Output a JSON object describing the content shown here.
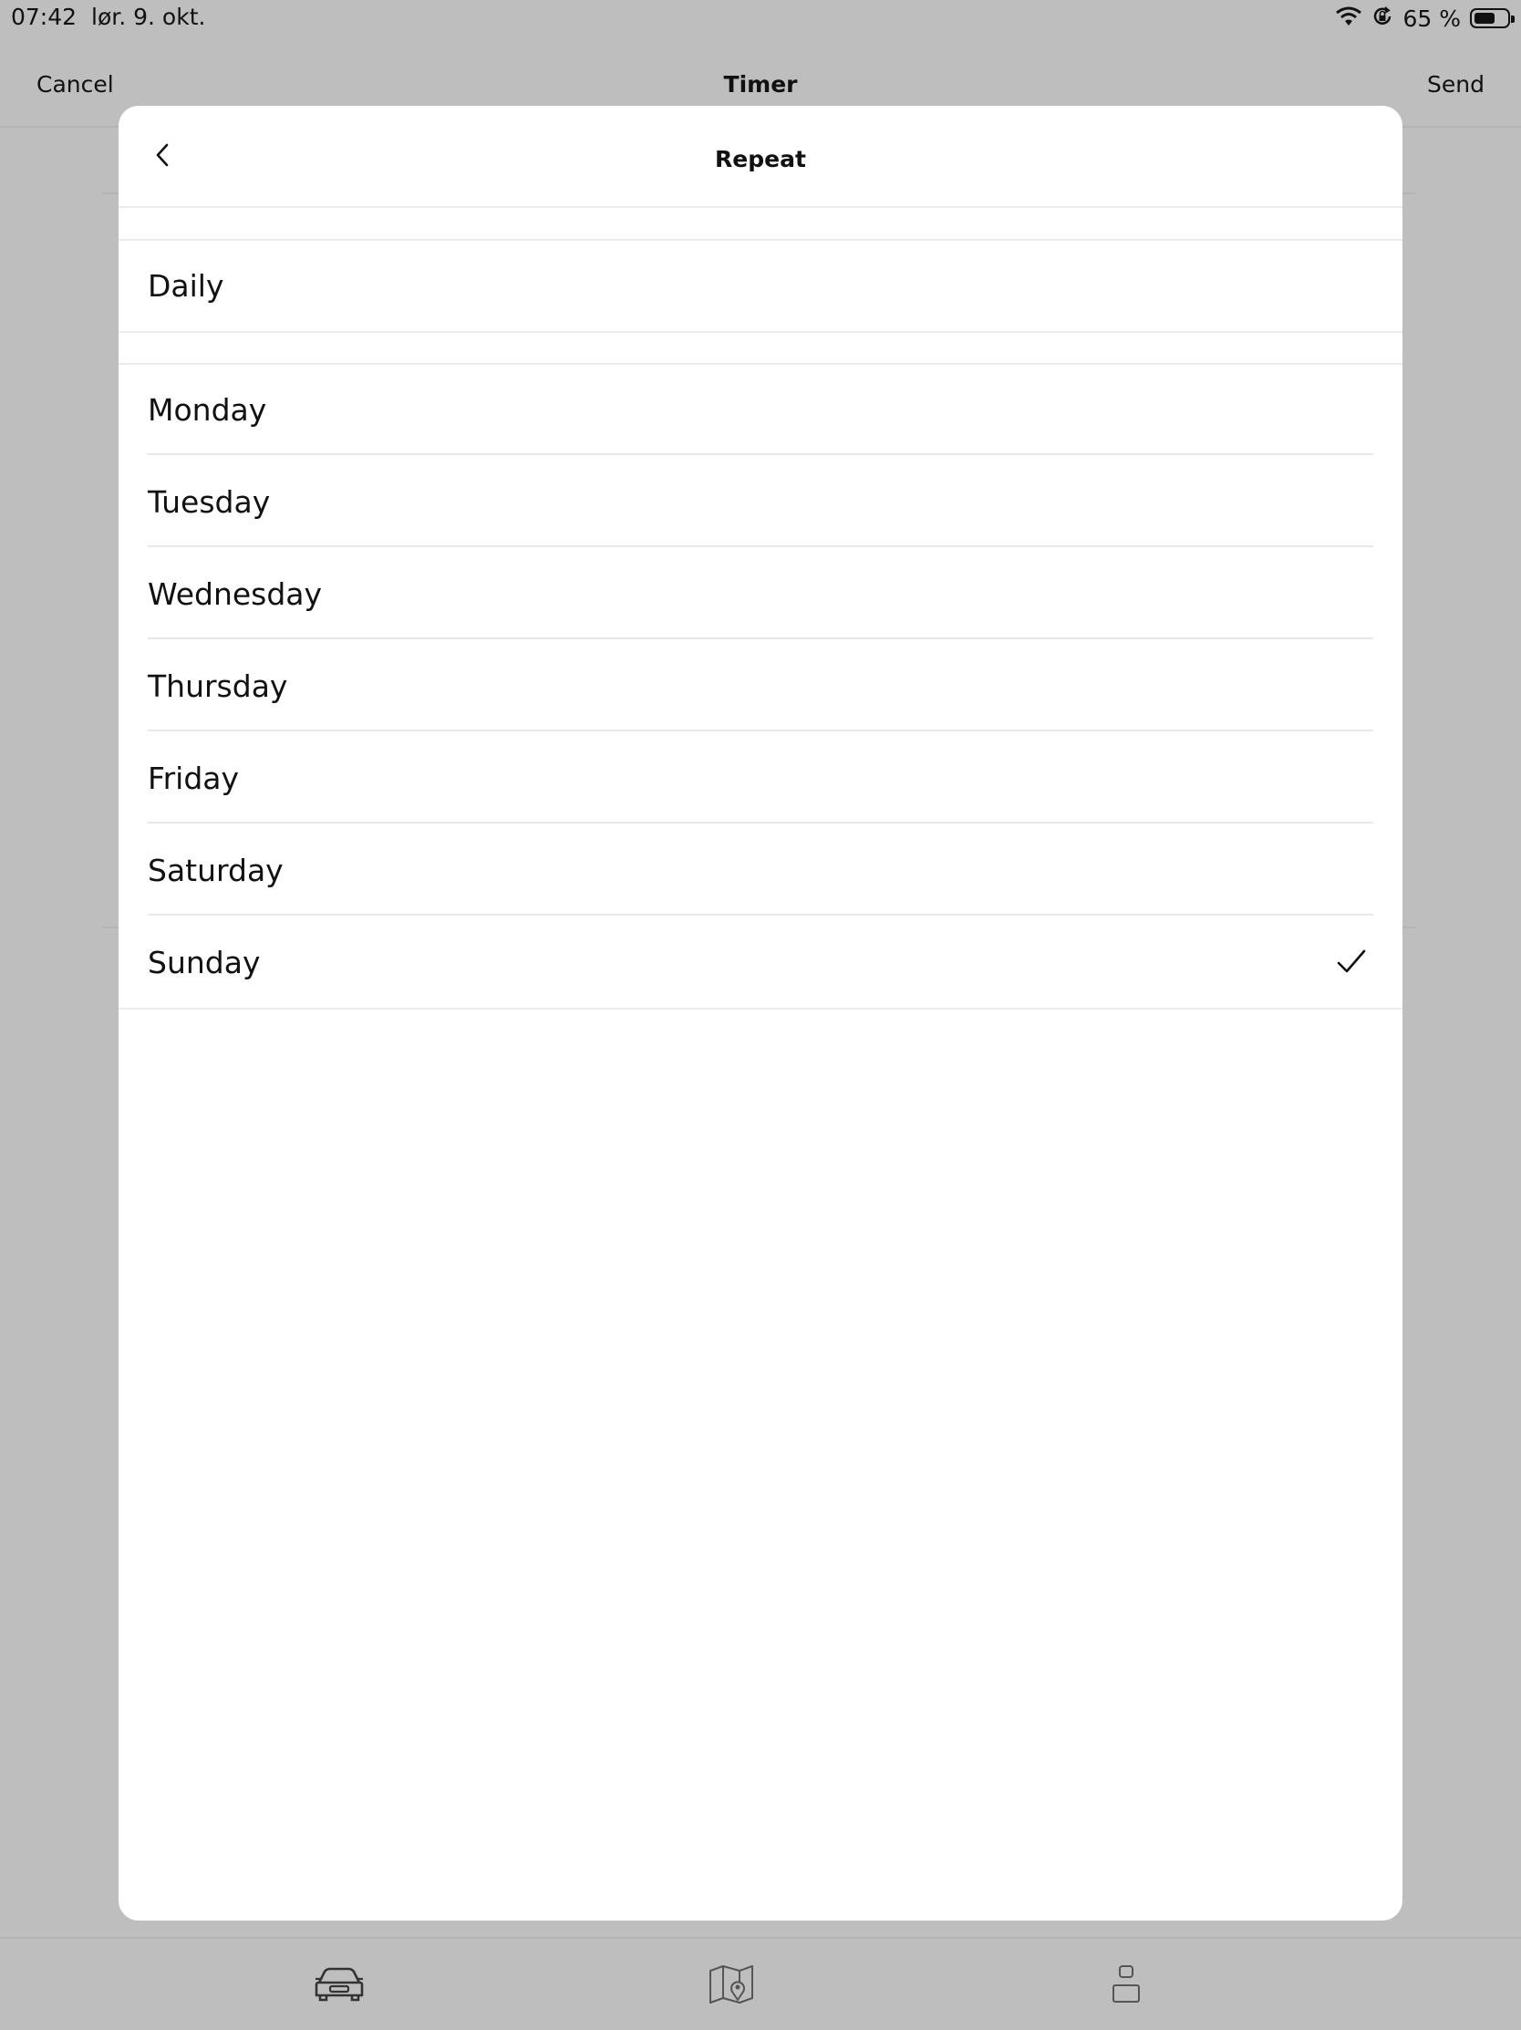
{
  "status_bar": {
    "time": "07:42",
    "date": "lør. 9. okt.",
    "battery_percent": "65 %",
    "battery_level": 0.65,
    "icons": [
      "wifi-icon",
      "orientation-lock-icon",
      "battery-icon"
    ]
  },
  "background_nav": {
    "cancel_label": "Cancel",
    "title": "Timer",
    "send_label": "Send"
  },
  "modal": {
    "title": "Repeat",
    "back_icon": "chevron-left-icon",
    "options": [
      {
        "label": "Daily",
        "checked": false
      },
      {
        "label": "Monday",
        "checked": false
      },
      {
        "label": "Tuesday",
        "checked": false
      },
      {
        "label": "Wednesday",
        "checked": false
      },
      {
        "label": "Thursday",
        "checked": false
      },
      {
        "label": "Friday",
        "checked": false
      },
      {
        "label": "Saturday",
        "checked": false
      },
      {
        "label": "Sunday",
        "checked": true
      }
    ]
  },
  "tab_bar": {
    "tabs": [
      {
        "icon": "car-icon",
        "active": true
      },
      {
        "icon": "map-icon",
        "active": false
      },
      {
        "icon": "profile-icon",
        "active": false
      }
    ]
  },
  "colors": {
    "overlay_background": "#bdbebd",
    "modal_background": "#ffffff",
    "text": "#111111",
    "divider": "#e8e8e8"
  }
}
